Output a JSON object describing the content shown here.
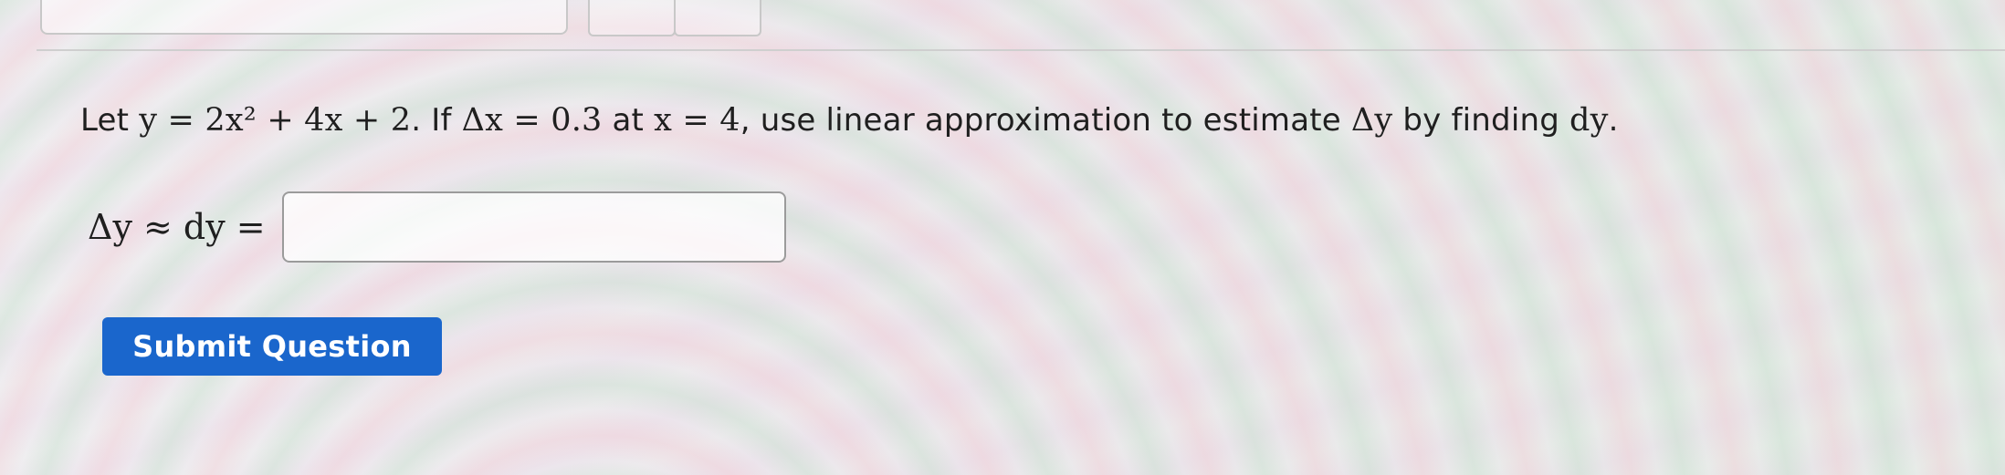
{
  "question": {
    "lead": "Let ",
    "equation": "y = 2x² + 4x + 2",
    "part2": ". If ",
    "delta_x": "Δx = 0.3",
    "part3": " at ",
    "x_value": "x = 4",
    "part4": ", use linear approximation to estimate ",
    "delta_y": "Δy",
    "part5": " by finding ",
    "dy": "dy",
    "end": "."
  },
  "answer": {
    "label": "Δy ≈ dy =",
    "value": "",
    "placeholder": ""
  },
  "submit": {
    "label": "Submit Question"
  },
  "colors": {
    "button": "#1a66cc",
    "button_text": "#ffffff",
    "input_border": "#9b9b9b"
  }
}
